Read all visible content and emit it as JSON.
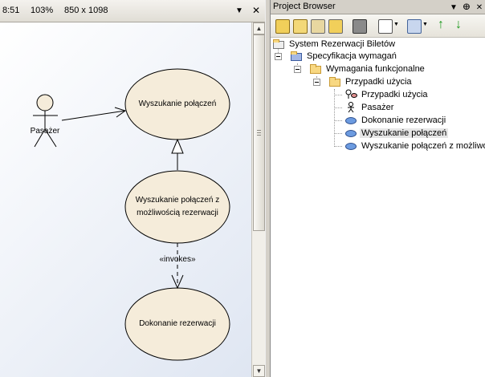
{
  "diagram": {
    "header": {
      "time": "8:51",
      "zoom": "103%",
      "size": "850 x 1098"
    },
    "actor": {
      "name": "Pasażer"
    },
    "use_cases": {
      "search": "Wyszukanie połączeń",
      "search_with_reservation_line1": "Wyszukanie połączeń z",
      "search_with_reservation_line2": "możliwością rezerwacji",
      "reservation": "Dokonanie rezerwacji"
    },
    "stereotype": "«invokes»"
  },
  "project_browser": {
    "title": "Project Browser",
    "tree": {
      "root": "System Rezerwacji Biletów",
      "spec": "Specyfikacja wymagań",
      "functional": "Wymagania funkcjonalne",
      "use_cases_pkg": "Przypadki użycia",
      "uc_diagram": "Przypadki użycia",
      "actor": "Pasażer",
      "uc_reservation": "Dokonanie rezerwacji",
      "uc_search": "Wyszukanie połączeń",
      "uc_search_reservation": "Wyszukanie połączeń z możliwo"
    }
  },
  "colors": {
    "usecase_fill": "#f5ecda",
    "selection": "#e6e6e6"
  }
}
